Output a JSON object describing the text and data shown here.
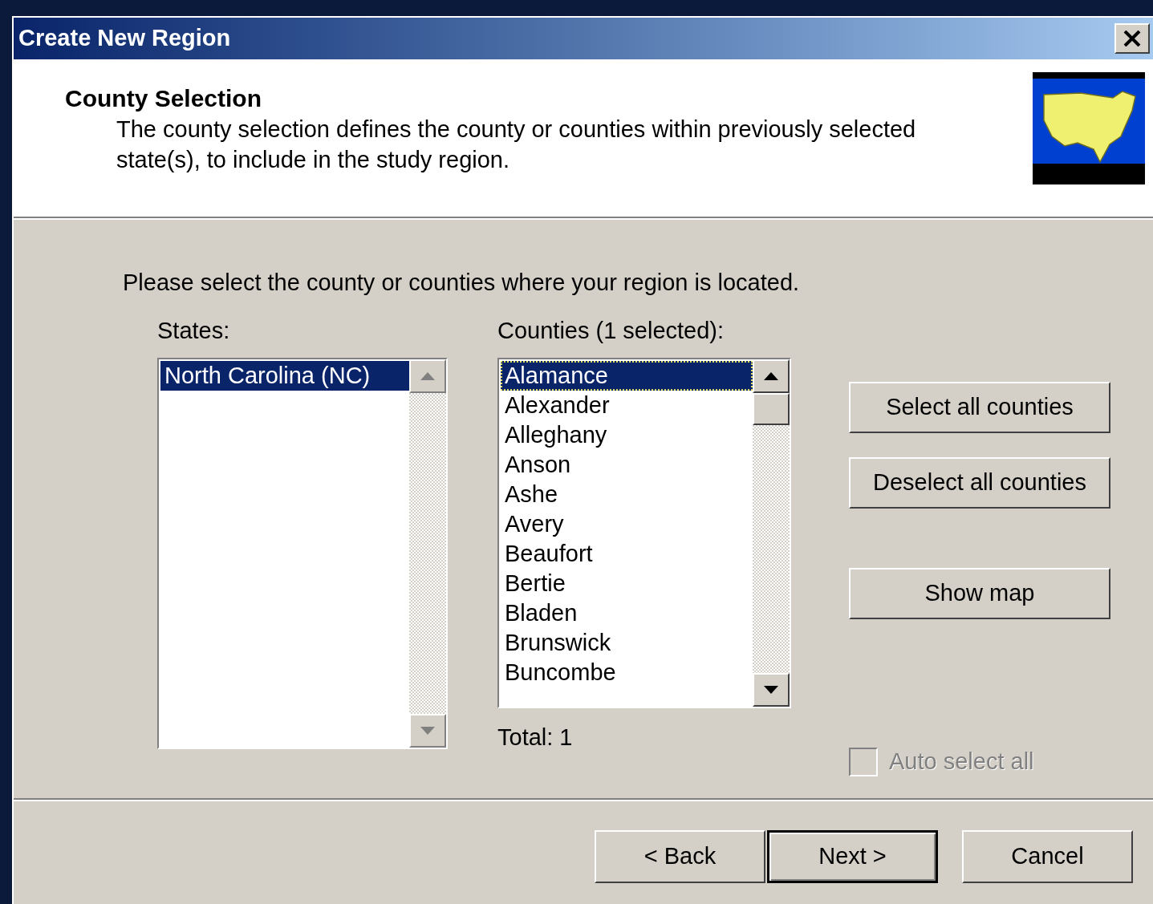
{
  "window": {
    "title": "Create New Region"
  },
  "header": {
    "title": "County Selection",
    "description": "The county selection defines the county or counties within previously selected state(s), to include in the study region."
  },
  "instruction": "Please select the county or counties where your region is located.",
  "states": {
    "label": "States:",
    "items": [
      {
        "label": "North Carolina (NC)",
        "selected": true
      }
    ]
  },
  "counties": {
    "label": "Counties (1 selected):",
    "total": "Total: 1",
    "items": [
      {
        "label": "Alamance",
        "selected": true
      },
      {
        "label": "Alexander",
        "selected": false
      },
      {
        "label": "Alleghany",
        "selected": false
      },
      {
        "label": "Anson",
        "selected": false
      },
      {
        "label": "Ashe",
        "selected": false
      },
      {
        "label": "Avery",
        "selected": false
      },
      {
        "label": "Beaufort",
        "selected": false
      },
      {
        "label": "Bertie",
        "selected": false
      },
      {
        "label": "Bladen",
        "selected": false
      },
      {
        "label": "Brunswick",
        "selected": false
      },
      {
        "label": "Buncombe",
        "selected": false
      }
    ]
  },
  "side_buttons": [
    {
      "label": "Select all counties"
    },
    {
      "label": "Deselect all counties"
    },
    {
      "label": "Show map"
    }
  ],
  "auto_select": {
    "label": "Auto select all",
    "checked": false,
    "disabled": true
  },
  "footer_buttons": [
    {
      "label": "< Back",
      "default": false
    },
    {
      "label": "Next >",
      "default": true
    },
    {
      "label": "Cancel",
      "default": false
    }
  ]
}
